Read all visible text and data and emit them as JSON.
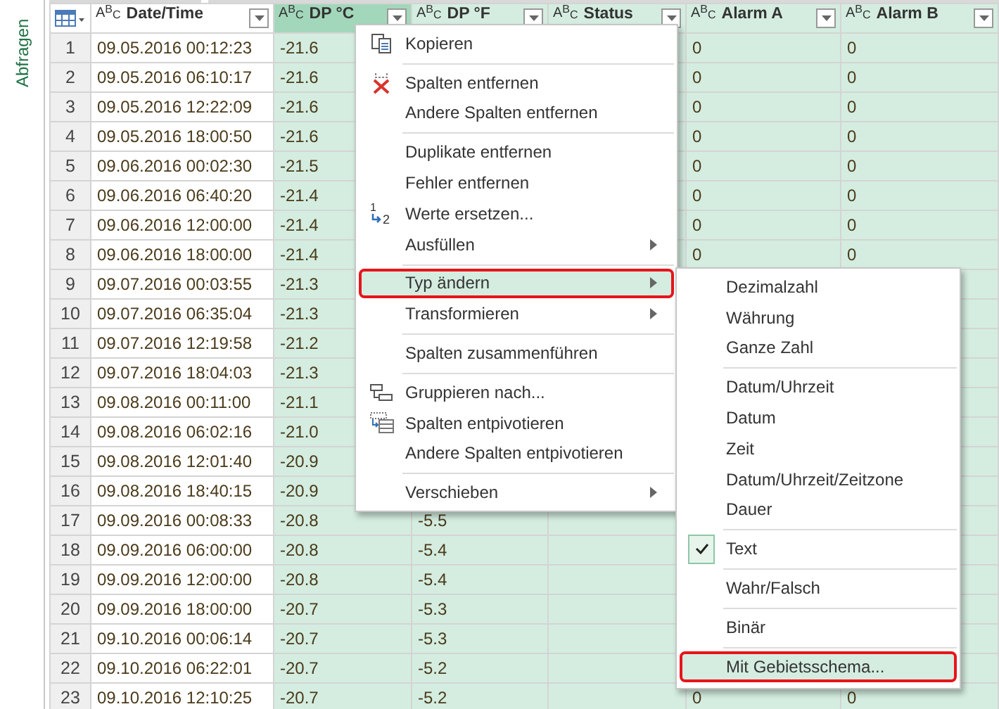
{
  "sidebar": {
    "title": "Abfragen"
  },
  "table": {
    "columns": [
      {
        "label": "Date/Time",
        "type": "A$^{B}$$_{C}$",
        "selected": false,
        "active": false
      },
      {
        "label": "DP °C",
        "type": "A$^{B}$$_{C}$",
        "selected": true,
        "active": true
      },
      {
        "label": "DP °F",
        "type": "A$^{B}$$_{C}$",
        "selected": true,
        "active": false
      },
      {
        "label": "Status",
        "type": "A$^{B}$$_{C}$",
        "selected": true,
        "active": false
      },
      {
        "label": "Alarm A",
        "type": "A$^{B}$$_{C}$",
        "selected": true,
        "active": false
      },
      {
        "label": "Alarm B",
        "type": "A$^{B}$$_{C}$",
        "selected": true,
        "active": false
      }
    ],
    "rows": [
      {
        "num": "1",
        "cells": [
          "09.05.2016 00:12:23",
          "-21.6",
          null,
          null,
          "0",
          "0"
        ]
      },
      {
        "num": "2",
        "cells": [
          "09.05.2016 06:10:17",
          "-21.6",
          null,
          null,
          "0",
          "0"
        ]
      },
      {
        "num": "3",
        "cells": [
          "09.05.2016 12:22:09",
          "-21.6",
          null,
          null,
          "0",
          "0"
        ]
      },
      {
        "num": "4",
        "cells": [
          "09.05.2016 18:00:50",
          "-21.6",
          null,
          null,
          "0",
          "0"
        ]
      },
      {
        "num": "5",
        "cells": [
          "09.06.2016 00:02:30",
          "-21.5",
          null,
          null,
          "0",
          "0"
        ]
      },
      {
        "num": "6",
        "cells": [
          "09.06.2016 06:40:20",
          "-21.4",
          null,
          null,
          "0",
          "0"
        ]
      },
      {
        "num": "7",
        "cells": [
          "09.06.2016 12:00:00",
          "-21.4",
          null,
          null,
          "0",
          "0"
        ]
      },
      {
        "num": "8",
        "cells": [
          "09.06.2016 18:00:00",
          "-21.4",
          null,
          null,
          "0",
          "0"
        ]
      },
      {
        "num": "9",
        "cells": [
          "09.07.2016 00:03:55",
          "-21.3",
          null,
          null,
          null,
          null
        ]
      },
      {
        "num": "10",
        "cells": [
          "09.07.2016 06:35:04",
          "-21.3",
          null,
          null,
          null,
          null
        ]
      },
      {
        "num": "11",
        "cells": [
          "09.07.2016 12:19:58",
          "-21.2",
          null,
          null,
          null,
          null
        ]
      },
      {
        "num": "12",
        "cells": [
          "09.07.2016 18:04:03",
          "-21.3",
          null,
          null,
          null,
          null
        ]
      },
      {
        "num": "13",
        "cells": [
          "09.08.2016 00:11:00",
          "-21.1",
          null,
          null,
          null,
          null
        ]
      },
      {
        "num": "14",
        "cells": [
          "09.08.2016 06:02:16",
          "-21.0",
          null,
          null,
          null,
          null
        ]
      },
      {
        "num": "15",
        "cells": [
          "09.08.2016 12:01:40",
          "-20.9",
          null,
          null,
          null,
          null
        ]
      },
      {
        "num": "16",
        "cells": [
          "09.08.2016 18:40:15",
          "-20.9",
          null,
          null,
          null,
          null
        ]
      },
      {
        "num": "17",
        "cells": [
          "09.09.2016 00:08:33",
          "-20.8",
          "-5.5",
          null,
          null,
          null
        ]
      },
      {
        "num": "18",
        "cells": [
          "09.09.2016 06:00:00",
          "-20.8",
          "-5.4",
          null,
          null,
          null
        ]
      },
      {
        "num": "19",
        "cells": [
          "09.09.2016 12:00:00",
          "-20.8",
          "-5.4",
          null,
          null,
          null
        ]
      },
      {
        "num": "20",
        "cells": [
          "09.09.2016 18:00:00",
          "-20.7",
          "-5.3",
          null,
          null,
          null
        ]
      },
      {
        "num": "21",
        "cells": [
          "09.10.2016 00:06:14",
          "-20.7",
          "-5.3",
          null,
          null,
          null
        ]
      },
      {
        "num": "22",
        "cells": [
          "09.10.2016 06:22:01",
          "-20.7",
          "-5.2",
          null,
          null,
          null
        ]
      },
      {
        "num": "23",
        "cells": [
          "09.10.2016 12:10:25",
          "-20.7",
          "-5.2",
          null,
          "0",
          "0"
        ]
      }
    ]
  },
  "context_menu": {
    "items": [
      {
        "kind": "copy",
        "label": "Kopieren",
        "selected": false
      },
      {
        "kind": "separator"
      },
      {
        "kind": "delete",
        "label": "Spalten entfernen",
        "selected": false
      },
      {
        "kind": "item",
        "label": "Andere Spalten entfernen",
        "selected": false
      },
      {
        "kind": "separator"
      },
      {
        "kind": "item",
        "label": "Duplikate entfernen",
        "selected": false
      },
      {
        "kind": "item",
        "label": "Fehler entfernen",
        "selected": false
      },
      {
        "kind": "replace",
        "label": "Werte ersetzen...",
        "icon_digits": [
          "1",
          "2"
        ],
        "selected": false
      },
      {
        "kind": "submenu",
        "label": "Ausfüllen",
        "selected": false
      },
      {
        "kind": "separator"
      },
      {
        "kind": "submenu",
        "label": "Typ ändern",
        "selected": true
      },
      {
        "kind": "submenu",
        "label": "Transformieren",
        "selected": false
      },
      {
        "kind": "separator"
      },
      {
        "kind": "item",
        "label": "Spalten zusammenführen",
        "selected": false
      },
      {
        "kind": "separator"
      },
      {
        "kind": "group",
        "label": "Gruppieren nach...",
        "selected": false
      },
      {
        "kind": "unpivot",
        "label": "Spalten entpivotieren",
        "selected": false
      },
      {
        "kind": "item",
        "label": "Andere Spalten entpivotieren",
        "selected": false
      },
      {
        "kind": "separator"
      },
      {
        "kind": "submenu",
        "label": "Verschieben",
        "selected": false
      }
    ]
  },
  "type_submenu": {
    "items": [
      {
        "kind": "item",
        "label": "Dezimalzahl",
        "selected": false,
        "checked": false
      },
      {
        "kind": "item",
        "label": "Währung",
        "selected": false,
        "checked": false
      },
      {
        "kind": "item",
        "label": "Ganze Zahl",
        "selected": false,
        "checked": false
      },
      {
        "kind": "separator"
      },
      {
        "kind": "item",
        "label": "Datum/Uhrzeit",
        "selected": false,
        "checked": false
      },
      {
        "kind": "item",
        "label": "Datum",
        "selected": false,
        "checked": false
      },
      {
        "kind": "item",
        "label": "Zeit",
        "selected": false,
        "checked": false
      },
      {
        "kind": "item",
        "label": "Datum/Uhrzeit/Zeitzone",
        "selected": false,
        "checked": false
      },
      {
        "kind": "item",
        "label": "Dauer",
        "selected": false,
        "checked": false
      },
      {
        "kind": "separator"
      },
      {
        "kind": "item",
        "label": "Text",
        "selected": false,
        "checked": true
      },
      {
        "kind": "separator"
      },
      {
        "kind": "item",
        "label": "Wahr/Falsch",
        "selected": false,
        "checked": false
      },
      {
        "kind": "separator"
      },
      {
        "kind": "item",
        "label": "Binär",
        "selected": false,
        "checked": false
      },
      {
        "kind": "separator"
      },
      {
        "kind": "item",
        "label": "Mit Gebietsschema...",
        "selected": true,
        "checked": false
      }
    ]
  }
}
